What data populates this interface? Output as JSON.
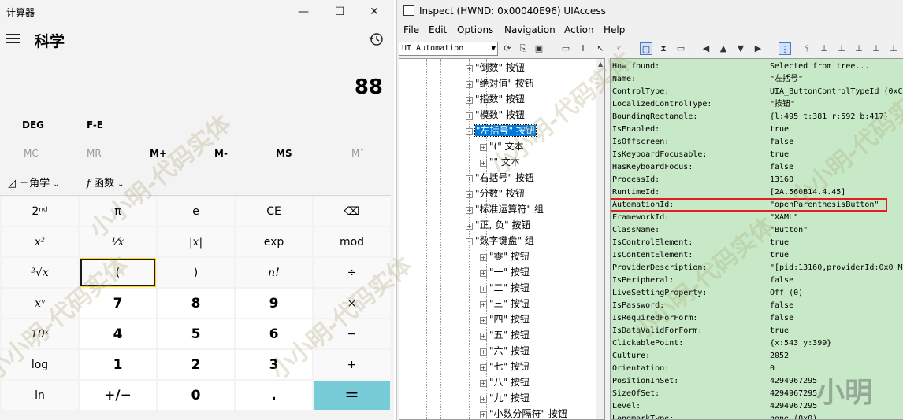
{
  "calculator": {
    "app_title": "计算器",
    "window_controls": {
      "minimize": "—",
      "maximize": "☐",
      "close": "✕"
    },
    "mode_title": "科学",
    "display_value": "88",
    "angle_mode": "DEG",
    "fe_label": "F-E",
    "memory": [
      "MC",
      "MR",
      "M+",
      "M-",
      "MS",
      "M˅"
    ],
    "trig_label": "三角学",
    "func_label": "函数",
    "keys": [
      [
        "2ⁿᵈ",
        "π",
        "e",
        "CE",
        "⌫"
      ],
      [
        "x²",
        "¹⁄x",
        "|x|",
        "exp",
        "mod"
      ],
      [
        "²√x",
        "(",
        ")",
        "n!",
        "÷"
      ],
      [
        "xʸ",
        "7",
        "8",
        "9",
        "×"
      ],
      [
        "10ˣ",
        "4",
        "5",
        "6",
        "−"
      ],
      [
        "log",
        "1",
        "2",
        "3",
        "+"
      ],
      [
        "ln",
        "+/−",
        "0",
        ".",
        "="
      ]
    ]
  },
  "inspect": {
    "title": "Inspect  (HWND: 0x00040E96) UIAccess",
    "menu": [
      "File",
      "Edit",
      "Options",
      "Navigation",
      "Action",
      "Help"
    ],
    "mode_combo": "UI Automation",
    "tree": [
      {
        "label": "\"倒数\" 按钮",
        "expander": "+",
        "level": 0
      },
      {
        "label": "\"绝对值\" 按钮",
        "expander": "+",
        "level": 0
      },
      {
        "label": "\"指数\" 按钮",
        "expander": "+",
        "level": 0
      },
      {
        "label": "\"模数\" 按钮",
        "expander": "+",
        "level": 0
      },
      {
        "label": "\"左括号\" 按钮",
        "expander": "-",
        "level": 0,
        "selected": true
      },
      {
        "label": "\"(\" 文本",
        "expander": "+",
        "level": 1
      },
      {
        "label": "\"\" 文本",
        "expander": "+",
        "level": 1
      },
      {
        "label": "\"右括号\" 按钮",
        "expander": "+",
        "level": 0
      },
      {
        "label": "\"分数\" 按钮",
        "expander": "+",
        "level": 0
      },
      {
        "label": "\"标准运算符\" 组",
        "expander": "+",
        "level": 0
      },
      {
        "label": "\"正, 负\" 按钮",
        "expander": "+",
        "level": 0
      },
      {
        "label": "\"数字键盘\" 组",
        "expander": "-",
        "level": 0
      },
      {
        "label": "\"零\" 按钮",
        "expander": "+",
        "level": 1
      },
      {
        "label": "\"一\" 按钮",
        "expander": "+",
        "level": 1
      },
      {
        "label": "\"二\" 按钮",
        "expander": "+",
        "level": 1
      },
      {
        "label": "\"三\" 按钮",
        "expander": "+",
        "level": 1
      },
      {
        "label": "\"四\" 按钮",
        "expander": "+",
        "level": 1
      },
      {
        "label": "\"五\" 按钮",
        "expander": "+",
        "level": 1
      },
      {
        "label": "\"六\" 按钮",
        "expander": "+",
        "level": 1
      },
      {
        "label": "\"七\" 按钮",
        "expander": "+",
        "level": 1
      },
      {
        "label": "\"八\" 按钮",
        "expander": "+",
        "level": 1
      },
      {
        "label": "\"九\" 按钮",
        "expander": "+",
        "level": 1
      },
      {
        "label": "\"小数分隔符\" 按钮",
        "expander": "+",
        "level": 1
      }
    ],
    "properties": [
      {
        "key": "How found:",
        "value": "Selected from tree..."
      },
      {
        "key": "Name:",
        "value": "\"左括号\""
      },
      {
        "key": "ControlType:",
        "value": "UIA_ButtonControlTypeId (0xC3"
      },
      {
        "key": "LocalizedControlType:",
        "value": "\"按钮\""
      },
      {
        "key": "BoundingRectangle:",
        "value": "{l:495 t:381 r:592 b:417}"
      },
      {
        "key": "IsEnabled:",
        "value": "true"
      },
      {
        "key": "IsOffscreen:",
        "value": "false"
      },
      {
        "key": "IsKeyboardFocusable:",
        "value": "true"
      },
      {
        "key": "HasKeyboardFocus:",
        "value": "false"
      },
      {
        "key": "ProcessId:",
        "value": "13160"
      },
      {
        "key": "RuntimeId:",
        "value": "[2A.560B14.4.45]"
      },
      {
        "key": "AutomationId:",
        "value": "\"openParenthesisButton\"",
        "highlight": true
      },
      {
        "key": "FrameworkId:",
        "value": "\"XAML\""
      },
      {
        "key": "ClassName:",
        "value": "\"Button\""
      },
      {
        "key": "IsControlElement:",
        "value": "true"
      },
      {
        "key": "IsContentElement:",
        "value": "true"
      },
      {
        "key": "ProviderDescription:",
        "value": "\"[pid:13160,providerId:0x0 Ma"
      },
      {
        "key": "IsPeripheral:",
        "value": "false"
      },
      {
        "key": "LiveSettingProperty:",
        "value": "Off (0)"
      },
      {
        "key": "IsPassword:",
        "value": "false"
      },
      {
        "key": "IsRequiredForForm:",
        "value": "false"
      },
      {
        "key": "IsDataValidForForm:",
        "value": "true"
      },
      {
        "key": "ClickablePoint:",
        "value": "{x:543 y:399}"
      },
      {
        "key": "Culture:",
        "value": "2052"
      },
      {
        "key": "Orientation:",
        "value": "0"
      },
      {
        "key": "PositionInSet:",
        "value": "4294967295"
      },
      {
        "key": "SizeOfSet:",
        "value": "4294967295"
      },
      {
        "key": "Level:",
        "value": "4294967295"
      },
      {
        "key": "LandmarkType:",
        "value": "none (0x0)"
      }
    ]
  },
  "watermark": {
    "text": "小小明-代码实体",
    "signature": "小明"
  }
}
